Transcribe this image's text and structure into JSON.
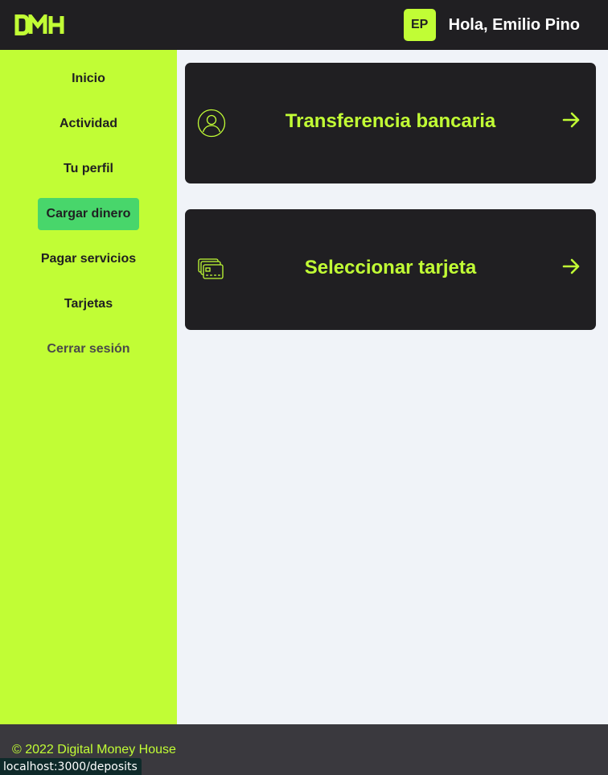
{
  "header": {
    "logo_icon": "dmh-logo",
    "avatar_initials": "EP",
    "greeting": "Hola, Emilio Pino"
  },
  "sidebar": {
    "items": [
      {
        "label": "Inicio"
      },
      {
        "label": "Actividad"
      },
      {
        "label": "Tu perfil"
      },
      {
        "label": "Cargar dinero",
        "active": true
      },
      {
        "label": "Pagar servicios"
      },
      {
        "label": "Tarjetas"
      },
      {
        "label": "Cerrar sesión"
      }
    ]
  },
  "main": {
    "cards": [
      {
        "title": "Transferencia bancaria",
        "icon": "user-circle-icon",
        "arrow_icon": "arrow-right-icon"
      },
      {
        "title": "Seleccionar tarjeta",
        "icon": "credit-card-icon",
        "arrow_icon": "arrow-right-icon"
      }
    ]
  },
  "footer": {
    "copyright": "© 2022 Digital Money House"
  },
  "browser_status": {
    "url": "localhost:3000/deposits"
  },
  "colors": {
    "accent": "#c1fd35",
    "dark": "#201f22",
    "active_nav": "#48d66b",
    "background": "#f0f3f8",
    "footer": "#3a393e"
  }
}
